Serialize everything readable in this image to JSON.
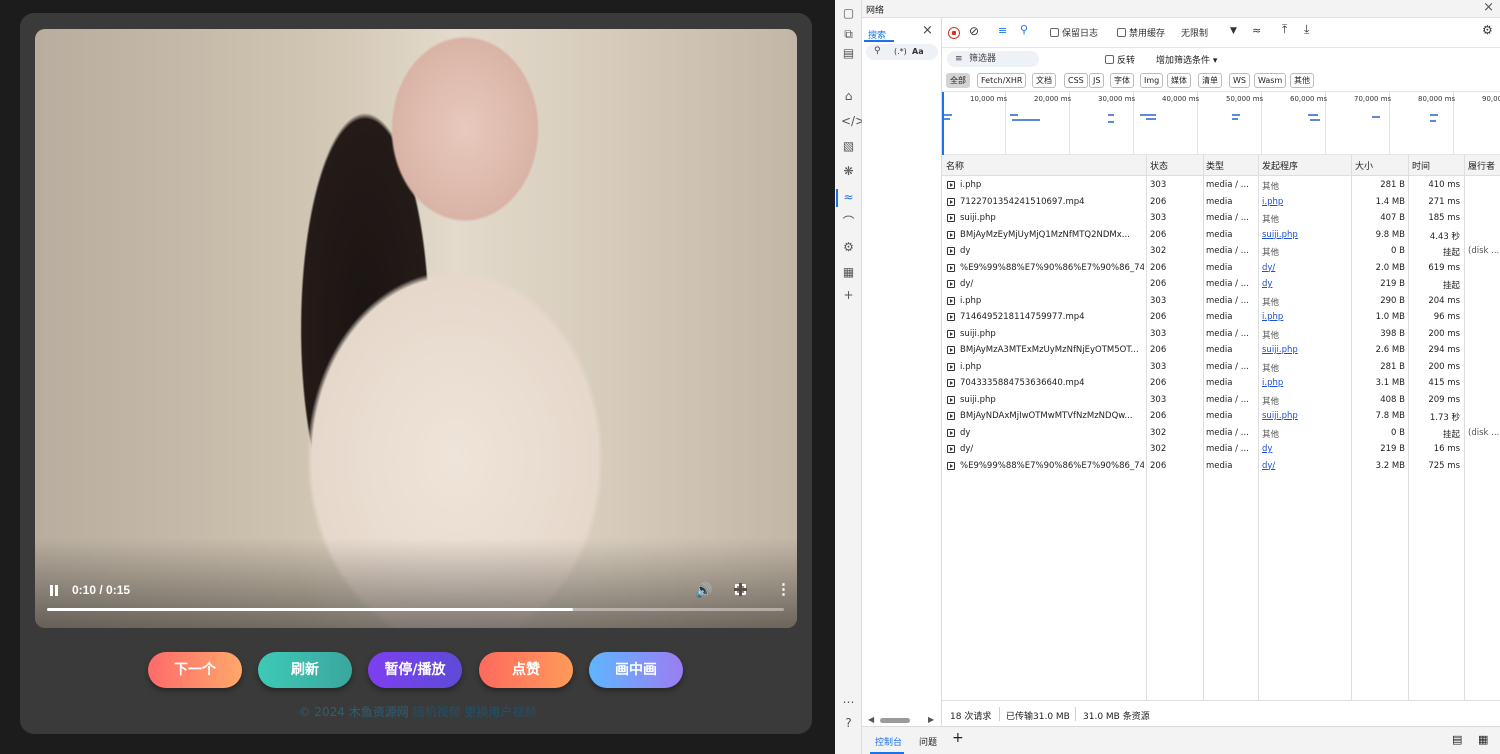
{
  "video": {
    "time": "0:10 / 0:15",
    "progress": 0.714
  },
  "buttons": [
    "下一个",
    "刷新",
    "暂停/播放",
    "点赞",
    "画中画"
  ],
  "footer": {
    "text": "© 2024 木鱼资源网",
    "links": [
      "随机视频",
      "更换用户视频"
    ]
  },
  "devtools": {
    "title": "网络",
    "search_tab": "搜索",
    "search_regex": "(.*)",
    "search_case": "Aa",
    "toolbar": {
      "preserve_log": "保留日志",
      "disable_cache": "禁用缓存",
      "throttle": "无限制"
    },
    "filter": {
      "placeholder": "筛选器",
      "invert": "反转",
      "more_filters": "增加筛选条件"
    },
    "types": [
      "全部",
      "Fetch/XHR",
      "文档",
      "CSS",
      "JS",
      "字体",
      "Img",
      "媒体",
      "清单",
      "WS",
      "Wasm",
      "其他"
    ],
    "timeline_labels": [
      "10,000 ms",
      "20,000 ms",
      "30,000 ms",
      "40,000 ms",
      "50,000 ms",
      "60,000 ms",
      "70,000 ms",
      "80,000 ms",
      "90,00"
    ],
    "columns": [
      "名称",
      "状态",
      "类型",
      "发起程序",
      "大小",
      "时间",
      "履行者"
    ],
    "rows": [
      {
        "name": "i.php",
        "status": "303",
        "type": "media / ...",
        "initiator": "其他",
        "size": "281 B",
        "time": "410 ms",
        "fulfilled": ""
      },
      {
        "name": "7122701354241510697.mp4",
        "status": "206",
        "type": "media",
        "initiator": "i.php",
        "size": "1.4 MB",
        "time": "271 ms",
        "fulfilled": ""
      },
      {
        "name": "suiji.php",
        "status": "303",
        "type": "media / ...",
        "initiator": "其他",
        "size": "407 B",
        "time": "185 ms",
        "fulfilled": ""
      },
      {
        "name": "BMjAyMzEyMjUyMjQ1MzNfMTQ2NDMx...",
        "status": "206",
        "type": "media",
        "initiator": "suiji.php",
        "size": "9.8 MB",
        "time": "4.43 秒",
        "fulfilled": ""
      },
      {
        "name": "dy",
        "status": "302",
        "type": "media / ...",
        "initiator": "其他",
        "size": "0 B",
        "time": "挂起",
        "fulfilled": "(disk ..."
      },
      {
        "name": "%E9%99%88%E7%90%86%E7%90%86_74...",
        "status": "206",
        "type": "media",
        "initiator": "dy/",
        "size": "2.0 MB",
        "time": "619 ms",
        "fulfilled": ""
      },
      {
        "name": "dy/",
        "status": "206",
        "type": "media / ...",
        "initiator": "dy",
        "size": "219 B",
        "time": "挂起",
        "fulfilled": ""
      },
      {
        "name": "i.php",
        "status": "303",
        "type": "media / ...",
        "initiator": "其他",
        "size": "290 B",
        "time": "204 ms",
        "fulfilled": ""
      },
      {
        "name": "7146495218114759977.mp4",
        "status": "206",
        "type": "media",
        "initiator": "i.php",
        "size": "1.0 MB",
        "time": "96 ms",
        "fulfilled": ""
      },
      {
        "name": "suiji.php",
        "status": "303",
        "type": "media / ...",
        "initiator": "其他",
        "size": "398 B",
        "time": "200 ms",
        "fulfilled": ""
      },
      {
        "name": "BMjAyMzA3MTExMzUyMzNfNjEyOTM5OT...",
        "status": "206",
        "type": "media",
        "initiator": "suiji.php",
        "size": "2.6 MB",
        "time": "294 ms",
        "fulfilled": ""
      },
      {
        "name": "i.php",
        "status": "303",
        "type": "media / ...",
        "initiator": "其他",
        "size": "281 B",
        "time": "200 ms",
        "fulfilled": ""
      },
      {
        "name": "7043335884753636640.mp4",
        "status": "206",
        "type": "media",
        "initiator": "i.php",
        "size": "3.1 MB",
        "time": "415 ms",
        "fulfilled": ""
      },
      {
        "name": "suiji.php",
        "status": "303",
        "type": "media / ...",
        "initiator": "其他",
        "size": "408 B",
        "time": "209 ms",
        "fulfilled": ""
      },
      {
        "name": "BMjAyNDAxMjIwOTMwMTVfNzMzNDQw...",
        "status": "206",
        "type": "media",
        "initiator": "suiji.php",
        "size": "7.8 MB",
        "time": "1.73 秒",
        "fulfilled": ""
      },
      {
        "name": "dy",
        "status": "302",
        "type": "media / ...",
        "initiator": "其他",
        "size": "0 B",
        "time": "挂起",
        "fulfilled": "(disk ..."
      },
      {
        "name": "dy/",
        "status": "302",
        "type": "media / ...",
        "initiator": "dy",
        "size": "219 B",
        "time": "16 ms",
        "fulfilled": ""
      },
      {
        "name": "%E9%99%88%E7%90%86%E7%90%86_74...",
        "status": "206",
        "type": "media",
        "initiator": "dy/",
        "size": "3.2 MB",
        "time": "725 ms",
        "fulfilled": ""
      }
    ],
    "summary": {
      "requests": "18 次请求",
      "transferred": "已传输31.0 MB",
      "resources": "31.0 MB 条资源"
    },
    "drawer": {
      "console": "控制台",
      "issues": "问题"
    }
  }
}
